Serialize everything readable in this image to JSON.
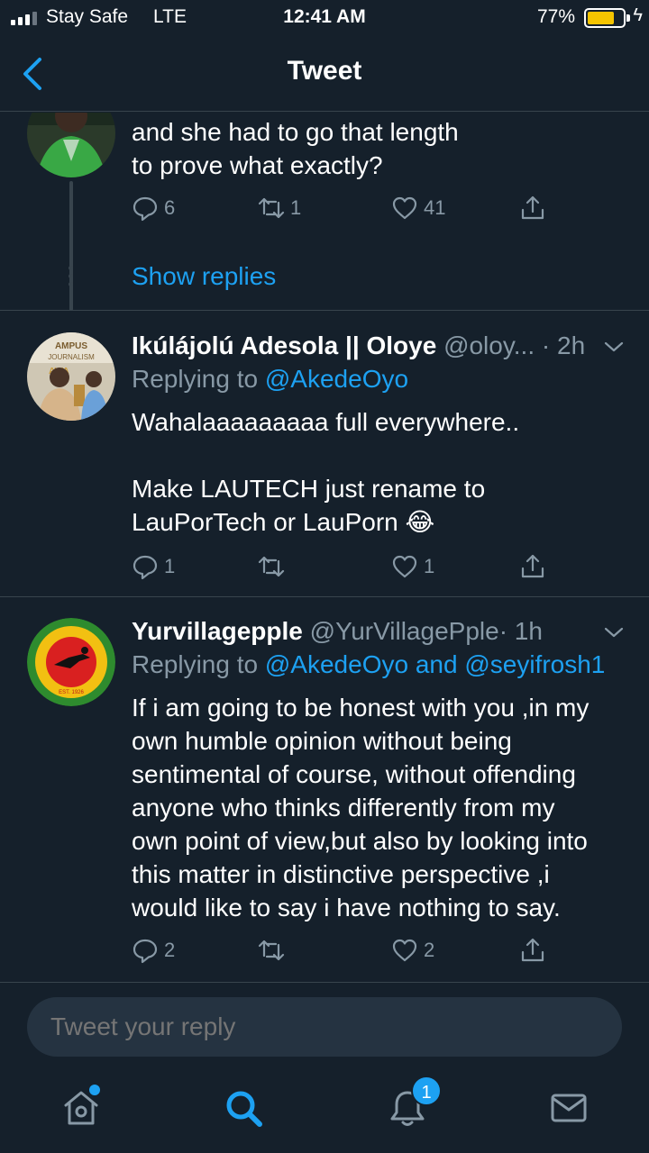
{
  "status_bar": {
    "carrier": "Stay Safe",
    "network": "LTE",
    "time": "12:41 AM",
    "battery": "77%",
    "battery_level": 0.77,
    "battery_color": "#f5c400"
  },
  "header": {
    "title": "Tweet"
  },
  "tweets": [
    {
      "text_lines": [
        "and she had to go that length",
        "to prove what exactly?"
      ],
      "replies": "6",
      "retweets": "1",
      "likes": "41",
      "show_replies": "Show replies"
    },
    {
      "name": "Ikúlájolú Adesola || Oloye",
      "handle": "@oloy...",
      "dot": "·",
      "time": "2h",
      "replying_label": "Replying to",
      "mentions": [
        "@AkedeOyo"
      ],
      "text_lines": [
        "Wahalaaaaaaaaa full everywhere..",
        "",
        "Make LAUTECH just rename to",
        "LauPorTech or LauPorn 😂"
      ],
      "replies": "1",
      "retweets": "",
      "likes": "1"
    },
    {
      "name": "Yurvillagepple",
      "handle": "@YurVillagePple",
      "dot": "·",
      "time": "1h",
      "replying_label": "Replying to",
      "mentions": [
        "@AkedeOyo",
        "@seyifrosh1"
      ],
      "and_word": "and",
      "text_lines": [
        "If i am going to be honest with you ,in my",
        "own humble opinion without being",
        "sentimental of course, without offending",
        "anyone who thinks differently from my",
        "own point of view,but also by looking into",
        "this matter in distinctive perspective ,i",
        "would like to say i have nothing to say."
      ],
      "replies": "2",
      "retweets": "",
      "likes": "2"
    }
  ],
  "reply_box": {
    "placeholder": "Tweet your reply"
  },
  "tab_bar": {
    "notifications_badge": "1",
    "icons": [
      "home-icon",
      "search-icon",
      "notifications-icon",
      "messages-icon"
    ]
  },
  "colors": {
    "background": "#15202b",
    "accent": "#1da1f2",
    "muted": "#8899a6",
    "divider": "#38444d"
  }
}
